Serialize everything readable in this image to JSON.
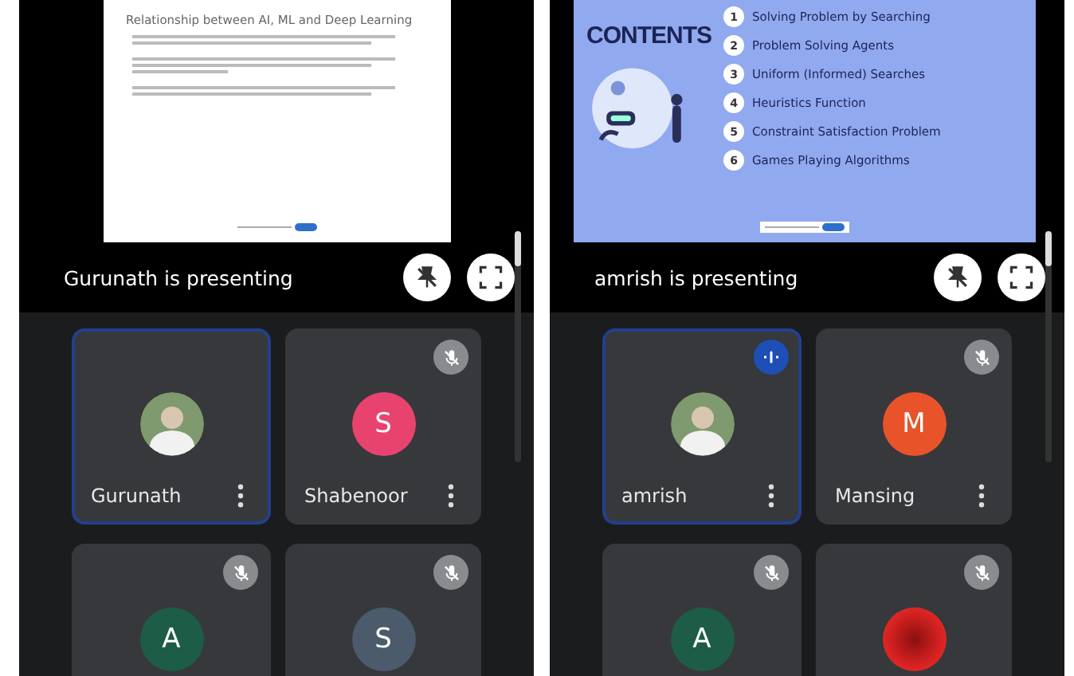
{
  "panels": [
    {
      "slide": {
        "kind": "text",
        "title": "Relationship between AI, ML and Deep Learning"
      },
      "presenter_text": "Gurunath is presenting",
      "tiles": [
        {
          "name": "Gurunath",
          "kind": "photo",
          "selected": true,
          "muted": false,
          "speaking": false
        },
        {
          "name": "Shabenoor",
          "kind": "initial",
          "initial": "S",
          "color": "#e8436f",
          "selected": false,
          "muted": true,
          "speaking": false
        },
        {
          "kind": "initial",
          "initial": "A",
          "color": "#1d5c47",
          "selected": false,
          "muted": true,
          "speaking": false
        },
        {
          "kind": "initial",
          "initial": "S",
          "color": "#4b5b6b",
          "selected": false,
          "muted": true,
          "speaking": false
        }
      ]
    },
    {
      "slide": {
        "kind": "contents",
        "title": "CONTENTS",
        "items": [
          {
            "number": "1",
            "label": "Solving Problem by Searching"
          },
          {
            "number": "2",
            "label": "Problem Solving Agents"
          },
          {
            "number": "3",
            "label": "Uniform (Informed) Searches"
          },
          {
            "number": "4",
            "label": "Heuristics Function"
          },
          {
            "number": "5",
            "label": "Constraint Satisfaction Problem"
          },
          {
            "number": "6",
            "label": "Games Playing Algorithms"
          }
        ]
      },
      "presenter_text": "amrish is presenting",
      "tiles": [
        {
          "name": "amrish",
          "kind": "photo",
          "selected": true,
          "muted": false,
          "speaking": true
        },
        {
          "name": "Mansing",
          "kind": "initial",
          "initial": "M",
          "color": "#e8532a",
          "selected": false,
          "muted": true,
          "speaking": false
        },
        {
          "kind": "initial",
          "initial": "A",
          "color": "#1d5c47",
          "selected": false,
          "muted": true,
          "speaking": false
        },
        {
          "kind": "picture",
          "selected": false,
          "muted": true,
          "speaking": false
        }
      ]
    }
  ]
}
